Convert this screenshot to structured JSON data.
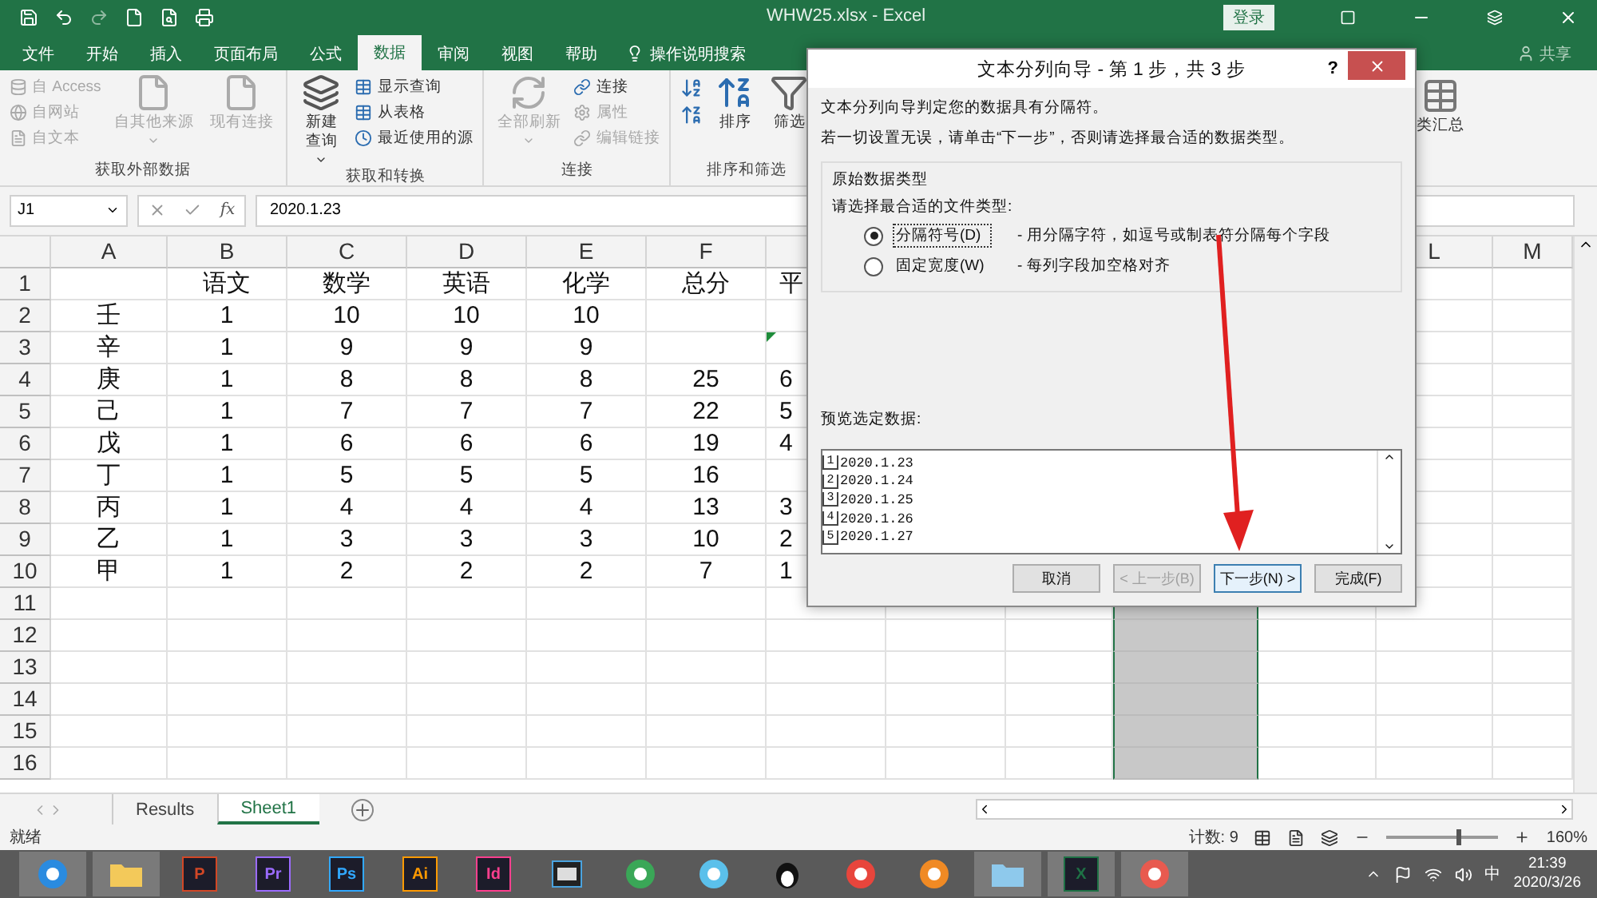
{
  "window": {
    "title": "WHW25.xlsx  -  Excel",
    "login_button": "登录"
  },
  "menu_tabs": [
    {
      "label": "文件",
      "selected": false
    },
    {
      "label": "开始",
      "selected": false
    },
    {
      "label": "插入",
      "selected": false
    },
    {
      "label": "页面布局",
      "selected": false
    },
    {
      "label": "公式",
      "selected": false
    },
    {
      "label": "数据",
      "selected": true
    },
    {
      "label": "审阅",
      "selected": false
    },
    {
      "label": "视图",
      "selected": false
    },
    {
      "label": "帮助",
      "selected": false
    }
  ],
  "tell_me": "操作说明搜索",
  "share": "共享",
  "ribbon_groups": [
    {
      "label": "获取外部数据",
      "items": [
        {
          "kind": "stack",
          "entries": [
            {
              "label": "自 Access",
              "disabled": true
            },
            {
              "label": "自网站",
              "disabled": true
            },
            {
              "label": "自文本",
              "disabled": true
            }
          ]
        },
        {
          "kind": "large",
          "label": "自其他来源",
          "disabled": true,
          "dropdown": true
        },
        {
          "kind": "large",
          "label": "现有连接",
          "disabled": true
        }
      ]
    },
    {
      "label": "获取和转换",
      "items": [
        {
          "kind": "large",
          "label": "新建查询",
          "disabled": false,
          "dropdown": true
        },
        {
          "kind": "stack",
          "entries": [
            {
              "label": "显示查询",
              "disabled": false
            },
            {
              "label": "从表格",
              "disabled": false
            },
            {
              "label": "最近使用的源",
              "disabled": false
            }
          ]
        }
      ]
    },
    {
      "label": "连接",
      "items": [
        {
          "kind": "large",
          "label": "全部刷新",
          "disabled": true,
          "dropdown": true
        },
        {
          "kind": "stack",
          "entries": [
            {
              "label": "连接",
              "disabled": false
            },
            {
              "label": "属性",
              "disabled": true
            },
            {
              "label": "编辑链接",
              "disabled": true
            }
          ]
        }
      ]
    },
    {
      "label": "排序和筛选",
      "items": [
        {
          "kind": "sort_icons"
        },
        {
          "kind": "large",
          "label": "排序",
          "disabled": false
        },
        {
          "kind": "large",
          "label": "筛选",
          "disabled": false
        }
      ]
    }
  ],
  "ribbon_right": {
    "label": "类汇总"
  },
  "formula_bar": {
    "name_box": "J1",
    "function_label": "fx",
    "value": "2020.1.23"
  },
  "columns": [
    {
      "label": "A",
      "selected": false
    },
    {
      "label": "B",
      "selected": false
    },
    {
      "label": "C",
      "selected": false
    },
    {
      "label": "D",
      "selected": false
    },
    {
      "label": "E",
      "selected": false
    },
    {
      "label": "F",
      "selected": false
    },
    {
      "selected": false
    },
    {
      "selected": false
    },
    {
      "selected": false
    },
    {
      "selected": true
    },
    {
      "selected": false
    },
    {
      "label": "L",
      "selected": false
    },
    {
      "label": "M",
      "selected": false
    }
  ],
  "rows": [
    {
      "number": "1",
      "b": "语文",
      "c": "数学",
      "d": "英语",
      "e": "化学",
      "f": "总分",
      "g": "平"
    },
    {
      "number": "2",
      "a": "壬",
      "b": "1",
      "c": "10",
      "d": "10",
      "e": "10"
    },
    {
      "number": "3",
      "a": "辛",
      "b": "1",
      "c": "9",
      "d": "9",
      "e": "9",
      "warning": true
    },
    {
      "number": "4",
      "a": "庚",
      "b": "1",
      "c": "8",
      "d": "8",
      "e": "8",
      "f": "25",
      "g": "6"
    },
    {
      "number": "5",
      "a": "己",
      "b": "1",
      "c": "7",
      "d": "7",
      "e": "7",
      "f": "22",
      "g": "5"
    },
    {
      "number": "6",
      "a": "戊",
      "b": "1",
      "c": "6",
      "d": "6",
      "e": "6",
      "f": "19",
      "g": "4"
    },
    {
      "number": "7",
      "a": "丁",
      "b": "1",
      "c": "5",
      "d": "5",
      "e": "5",
      "f": "16"
    },
    {
      "number": "8",
      "a": "丙",
      "b": "1",
      "c": "4",
      "d": "4",
      "e": "4",
      "f": "13",
      "g": "3"
    },
    {
      "number": "9",
      "a": "乙",
      "b": "1",
      "c": "3",
      "d": "3",
      "e": "3",
      "f": "10",
      "g": "2"
    },
    {
      "number": "10",
      "a": "甲",
      "b": "1",
      "c": "2",
      "d": "2",
      "e": "2",
      "f": "7",
      "g": "1"
    },
    {
      "number": "11"
    },
    {
      "number": "12"
    },
    {
      "number": "13"
    },
    {
      "number": "14"
    },
    {
      "number": "15"
    },
    {
      "number": "16"
    }
  ],
  "sheets": [
    {
      "label": "Results",
      "selected": false
    },
    {
      "label": "Sheet1",
      "selected": true
    }
  ],
  "status_bar": {
    "ready": "就绪",
    "count": "计数: 9",
    "zoom": "160%",
    "level": 0.62
  },
  "dialog": {
    "title": "文本分列向导 - 第 1 步，共 3 步",
    "help": "?",
    "intro": "文本分列向导判定您的数据具有分隔符。",
    "hint": "若一切设置无误，请单击“下一步”，否则请选择最合适的数据类型。",
    "group_title": "原始数据类型",
    "prompt": "请选择最合适的文件类型:",
    "options": [
      {
        "label": "分隔符号(D)",
        "description": "- 用分隔字符，如逗号或制表符分隔每个字段",
        "selected": true
      },
      {
        "label": "固定宽度(W)",
        "description": "- 每列字段加空格对齐",
        "selected": false
      }
    ],
    "preview_label": "预览选定数据:",
    "preview": [
      {
        "number": "1",
        "text": "2020.1.23"
      },
      {
        "number": "2",
        "text": "2020.1.24"
      },
      {
        "number": "3",
        "text": "2020.1.25"
      },
      {
        "number": "4",
        "text": "2020.1.26"
      },
      {
        "number": "5",
        "text": "2020.1.27"
      }
    ],
    "buttons": [
      {
        "label": "取消",
        "disabled": false,
        "default": false
      },
      {
        "label": "< 上一步(B)",
        "disabled": true,
        "default": false
      },
      {
        "label": "下一步(N) >",
        "disabled": false,
        "default": true
      },
      {
        "label": "完成(F)",
        "disabled": false,
        "default": false
      }
    ]
  },
  "taskbar": {
    "items": [
      {
        "kind": "circle",
        "color": "#2a8be0",
        "running": true
      },
      {
        "kind": "folder",
        "color": "#f3c95a",
        "running": true
      },
      {
        "kind": "tile",
        "label": "P",
        "color": "#d24726",
        "running": false
      },
      {
        "kind": "tile",
        "label": "Pr",
        "color": "#9b6bff",
        "running": false
      },
      {
        "kind": "tile",
        "label": "Ps",
        "color": "#31a8ff",
        "running": false
      },
      {
        "kind": "tile",
        "label": "Ai",
        "color": "#ff9a00",
        "running": false
      },
      {
        "kind": "tile",
        "label": "Id",
        "color": "#ff3f8e",
        "running": false
      },
      {
        "kind": "film",
        "color": "#4aa3df",
        "running": false
      },
      {
        "kind": "circle",
        "color": "#3aa757",
        "running": false
      },
      {
        "kind": "circle",
        "color": "#5bc0eb",
        "running": false
      },
      {
        "kind": "penguin",
        "color": "#111111",
        "running": false
      },
      {
        "kind": "circle",
        "color": "#e8453c",
        "running": false
      },
      {
        "kind": "circle",
        "color": "#f08a24",
        "running": false
      },
      {
        "kind": "folder",
        "color": "#8ec9ec",
        "running": true
      },
      {
        "kind": "tile",
        "label": "X",
        "color": "#1e7145",
        "running": true
      },
      {
        "kind": "circle",
        "color": "#e85a4f",
        "running": true
      }
    ],
    "ime": "中",
    "time": "21:39",
    "date": "2020/3/26"
  }
}
